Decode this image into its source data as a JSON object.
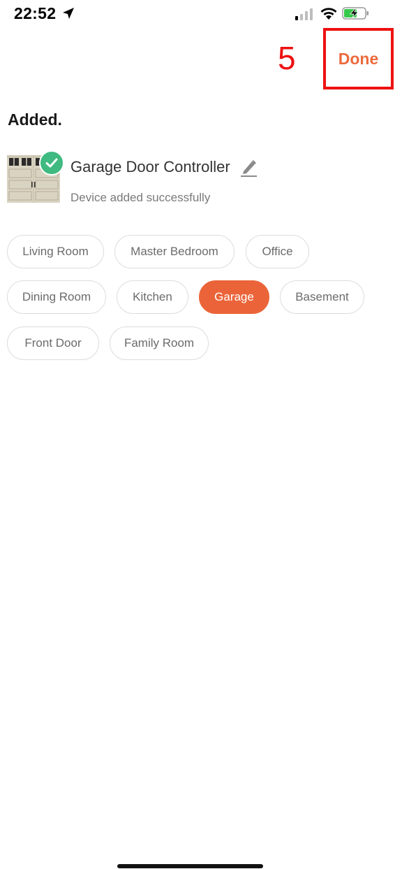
{
  "status_bar": {
    "time": "22:52",
    "icons": [
      "location-arrow-icon",
      "cellular-signal-icon",
      "wifi-icon",
      "battery-charging-icon"
    ],
    "battery_color": "#36c94b"
  },
  "nav": {
    "step_number": "5",
    "done_label": "Done",
    "accent_color": "#ec6a3e",
    "highlight_color": "#ee1111"
  },
  "section_title": "Added.",
  "device": {
    "name": "Garage Door Controller",
    "status": "Device added successfully",
    "check_color": "#3fba80"
  },
  "rooms": {
    "selected": "Garage",
    "items": [
      {
        "label": "Living Room"
      },
      {
        "label": "Master Bedroom"
      },
      {
        "label": "Office"
      },
      {
        "label": "Dining Room"
      },
      {
        "label": "Kitchen"
      },
      {
        "label": "Garage"
      },
      {
        "label": "Basement"
      },
      {
        "label": "Front Door"
      },
      {
        "label": "Family Room"
      }
    ]
  }
}
